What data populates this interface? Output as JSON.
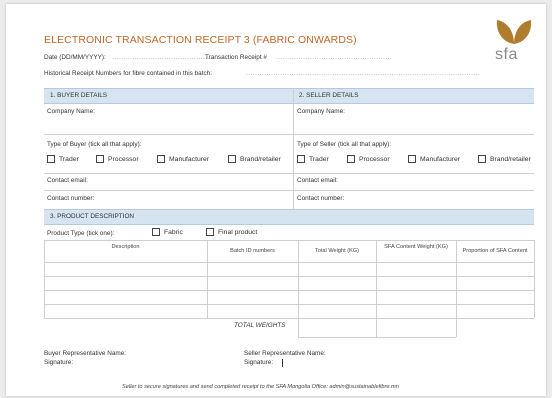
{
  "header": {
    "title": "ELECTRONIC TRANSACTION RECEIPT 3 (FABRIC ONWARDS)",
    "date_label": "Date (DD/MM/YYYY):",
    "date_dots": "............................................",
    "transaction_label": "Transaction Receipt #",
    "transaction_dots": "...................................................",
    "historical_label": "Historical Receipt Numbers for fibre contained in this batch:",
    "historical_dots": ".......................................................................................................",
    "logo_text": "sfa",
    "logo_colors": {
      "leaf": "#b07d2f"
    }
  },
  "buyer": {
    "heading": "1.   BUYER DETAILS",
    "company_label": "Company Name:",
    "type_label": "Type of Buyer (tick all that apply):",
    "options": [
      "Trader",
      "Processor",
      "Manufacturer",
      "Brand/retailer"
    ],
    "email_label": "Contact email:",
    "number_label": "Contact number:"
  },
  "seller": {
    "heading": "2.   SELLER DETAILS",
    "company_label": "Company Name:",
    "type_label": "Type of Seller (tick all that apply):",
    "options": [
      "Trader",
      "Processor",
      "Manufacturer",
      "Brand/retailer"
    ],
    "email_label": "Contact email:",
    "number_label": "Contact number:"
  },
  "product": {
    "heading": "3.   PRODUCT DESCRIPTION",
    "type_label": "Product Type (tick one):",
    "options": [
      "Fabric",
      "Final product"
    ],
    "columns": [
      "Description",
      "Batch ID numbers",
      "Total Weight (KG)",
      "SFA Content Weight (KG)",
      "Proportion of SFA Content"
    ],
    "total_label": "TOTAL WEIGHTS"
  },
  "signatures": {
    "buyer_rep_label": "Buyer Representative Name:",
    "buyer_sig_label": "Signature:",
    "seller_rep_label": "Seller Representative Name:",
    "seller_sig_label": "Signature:"
  },
  "footer": {
    "note": "Seller to secure signatures and send completed receipt to the SFA Mongolia Office: admin@sustainablefibre.mn"
  },
  "colors": {
    "title": "#c0672a",
    "section_header": "#d6e4f1",
    "border": "#cfcfcf"
  }
}
